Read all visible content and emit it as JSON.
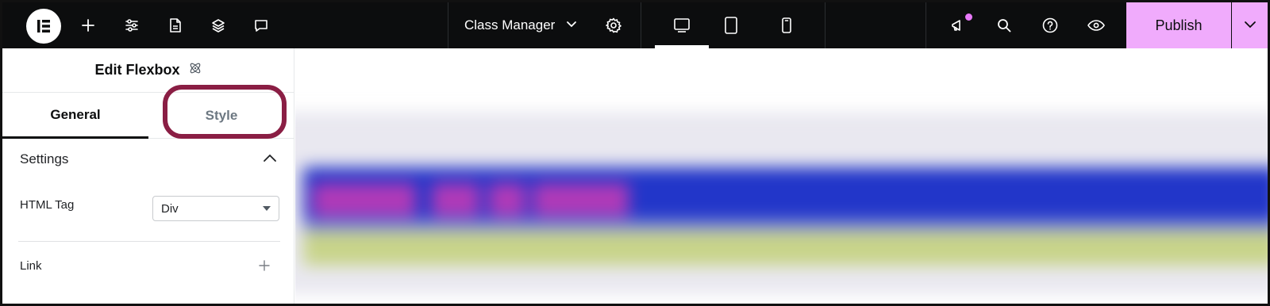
{
  "topbar": {
    "logo_icon": "elementor-logo-icon",
    "left_icons": [
      "plus-icon",
      "sliders-icon",
      "page-icon",
      "layers-icon",
      "comment-icon"
    ],
    "class_manager_label": "Class Manager",
    "device_icons": [
      "desktop-icon",
      "tablet-icon",
      "mobile-icon"
    ],
    "right_icons": [
      "announcement-icon",
      "search-icon",
      "help-icon",
      "eye-icon"
    ],
    "publish_label": "Publish",
    "accent_color": "#f0abfc"
  },
  "panel": {
    "title": "Edit Flexbox",
    "tabs": [
      {
        "label": "General",
        "active": true
      },
      {
        "label": "Style",
        "active": false
      }
    ],
    "section_title": "Settings",
    "html_tag_label": "HTML Tag",
    "html_tag_value": "Div",
    "link_label": "Link",
    "highlight_color": "#8a1e44"
  }
}
